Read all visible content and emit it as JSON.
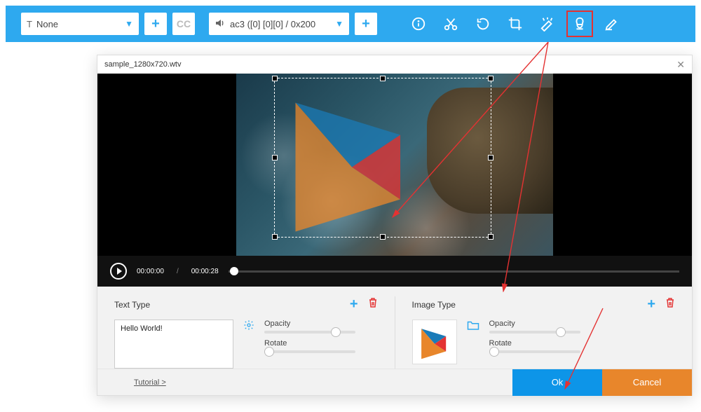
{
  "toolbar": {
    "subtitle_select": {
      "value": "None"
    },
    "cc_label": "CC",
    "audio_select": {
      "value": "ac3 ([0] [0][0] / 0x200"
    }
  },
  "dialog": {
    "title": "sample_1280x720.wtv",
    "playbar": {
      "current": "00:00:00",
      "total": "00:00:28"
    },
    "text_panel": {
      "title": "Text Type",
      "input_value": "Hello World!",
      "opacity_label": "Opacity",
      "rotate_label": "Rotate"
    },
    "image_panel": {
      "title": "Image Type",
      "opacity_label": "Opacity",
      "rotate_label": "Rotate"
    },
    "footer": {
      "tutorial": "Tutorial >",
      "ok": "Ok",
      "cancel": "Cancel"
    }
  }
}
